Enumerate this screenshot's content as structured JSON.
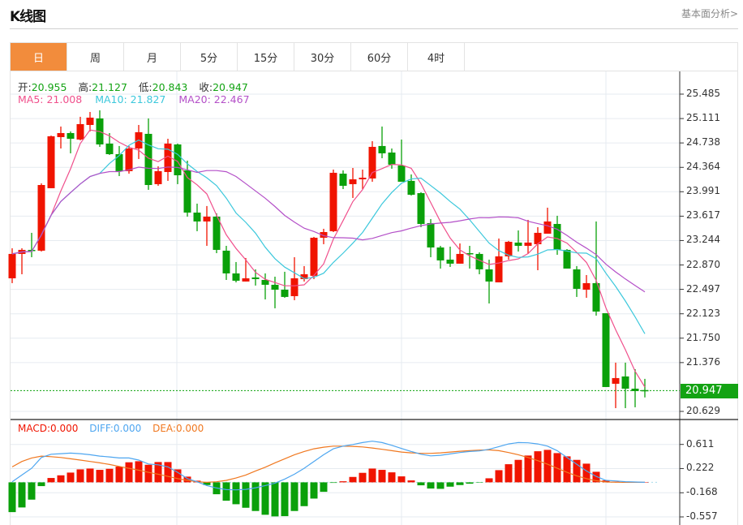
{
  "header": {
    "title": "K线图",
    "more_link": "基本面分析>"
  },
  "tabs": [
    {
      "label": "日",
      "active": true
    },
    {
      "label": "周"
    },
    {
      "label": "月"
    },
    {
      "label": "5分"
    },
    {
      "label": "15分"
    },
    {
      "label": "30分"
    },
    {
      "label": "60分"
    },
    {
      "label": "4时"
    }
  ],
  "ohlc": {
    "open_label": "开:",
    "open": "20.955",
    "high_label": "高:",
    "high": "21.127",
    "low_label": "低:",
    "low": "20.843",
    "close_label": "收:",
    "close": "20.947"
  },
  "ma_legend": {
    "ma5": "MA5: 21.008",
    "ma10": "MA10: 21.827",
    "ma20": "MA20: 22.467"
  },
  "macd_legend": {
    "macd": "MACD:0.000",
    "diff": "DIFF:0.000",
    "dea": "DEA:0.000"
  },
  "last_price": "20.947",
  "colors": {
    "up": "#f01400",
    "down": "#0aa00a",
    "ma5": "#f0508c",
    "ma10": "#3cc8dc",
    "ma20": "#b450c8",
    "diff": "#4ea6f0",
    "dea": "#f07820",
    "accent": "#f28c3c"
  },
  "chart_data": [
    {
      "type": "candlestick",
      "title": "K线图",
      "ylim": [
        20.629,
        25.485
      ],
      "y_ticks": [
        "25.485",
        "25.111",
        "24.738",
        "24.364",
        "23.991",
        "23.617",
        "23.244",
        "22.870",
        "22.497",
        "22.123",
        "21.750",
        "21.376",
        "20.629"
      ],
      "grid": true,
      "series_fields": [
        "open",
        "close",
        "high",
        "low"
      ],
      "candles": [
        [
          22.666,
          23.039,
          23.126,
          22.592
        ],
        [
          23.039,
          23.101,
          23.126,
          22.728
        ],
        [
          23.101,
          23.089,
          23.362,
          22.989
        ],
        [
          23.089,
          24.094,
          24.119,
          23.076
        ],
        [
          24.045,
          24.84,
          24.85,
          24.045
        ],
        [
          24.827,
          24.889,
          24.989,
          24.653
        ],
        [
          24.889,
          24.802,
          24.914,
          24.579
        ],
        [
          24.79,
          25.026,
          25.138,
          24.778
        ],
        [
          25.013,
          25.125,
          25.212,
          24.914
        ],
        [
          25.113,
          24.715,
          25.237,
          24.678
        ],
        [
          24.728,
          24.566,
          24.889,
          24.554
        ],
        [
          24.566,
          24.306,
          24.691,
          24.231
        ],
        [
          24.306,
          24.653,
          24.691,
          24.268
        ],
        [
          24.653,
          24.902,
          25.013,
          24.492
        ],
        [
          24.877,
          24.094,
          25.113,
          24.02
        ],
        [
          24.107,
          24.306,
          24.38,
          24.082
        ],
        [
          24.293,
          24.728,
          24.802,
          24.157
        ],
        [
          24.715,
          24.243,
          24.728,
          24.107
        ],
        [
          24.318,
          23.672,
          24.467,
          23.61
        ],
        [
          23.672,
          23.536,
          23.809,
          23.387
        ],
        [
          23.536,
          23.61,
          23.772,
          23.163
        ],
        [
          23.61,
          23.101,
          23.66,
          23.051
        ],
        [
          23.089,
          22.741,
          23.163,
          22.641
        ],
        [
          22.741,
          22.629,
          22.915,
          22.604
        ],
        [
          22.617,
          22.666,
          22.977,
          22.617
        ],
        [
          22.679,
          22.654,
          22.803,
          22.555
        ],
        [
          22.641,
          22.567,
          22.741,
          22.343
        ],
        [
          22.567,
          22.492,
          22.691,
          22.207
        ],
        [
          22.492,
          22.381,
          22.766,
          22.368
        ],
        [
          22.393,
          22.666,
          22.989,
          22.331
        ],
        [
          22.654,
          22.728,
          22.853,
          22.617
        ],
        [
          22.704,
          23.287,
          23.3,
          22.654
        ],
        [
          23.287,
          23.374,
          23.424,
          23.188
        ],
        [
          23.387,
          24.281,
          24.33,
          23.374
        ],
        [
          24.268,
          24.082,
          24.318,
          24.032
        ],
        [
          24.107,
          24.181,
          24.355,
          23.896
        ],
        [
          24.181,
          24.206,
          24.33,
          24.032
        ],
        [
          24.194,
          24.678,
          24.765,
          24.144
        ],
        [
          24.691,
          24.579,
          24.989,
          24.504
        ],
        [
          24.591,
          24.405,
          24.653,
          24.343
        ],
        [
          24.393,
          24.144,
          24.79,
          24.144
        ],
        [
          24.157,
          23.945,
          24.256,
          23.933
        ],
        [
          23.97,
          23.498,
          23.983,
          23.449
        ],
        [
          23.511,
          23.138,
          23.573,
          22.989
        ],
        [
          23.138,
          22.94,
          23.163,
          22.815
        ],
        [
          22.952,
          22.89,
          23.151,
          22.84
        ],
        [
          22.89,
          23.039,
          23.2,
          22.89
        ],
        [
          23.051,
          23.039,
          23.163,
          22.815
        ],
        [
          23.039,
          22.803,
          23.064,
          22.728
        ],
        [
          22.803,
          22.617,
          22.952,
          22.281
        ],
        [
          22.604,
          23.002,
          23.275,
          22.604
        ],
        [
          23.002,
          23.225,
          23.238,
          22.952
        ],
        [
          23.213,
          23.163,
          23.399,
          23.076
        ],
        [
          23.163,
          23.213,
          23.56,
          23.039
        ],
        [
          23.188,
          23.362,
          23.449,
          22.79
        ],
        [
          23.349,
          23.536,
          23.747,
          23.349
        ],
        [
          23.498,
          23.101,
          23.623,
          23.026
        ],
        [
          23.101,
          22.815,
          23.113,
          22.815
        ],
        [
          22.803,
          22.505,
          22.853,
          22.381
        ],
        [
          22.492,
          22.592,
          22.716,
          22.368
        ],
        [
          22.592,
          22.157,
          23.536,
          22.095
        ],
        [
          22.132,
          21.002,
          22.132,
          21.002
        ],
        [
          21.052,
          21.139,
          21.375,
          20.679
        ],
        [
          21.164,
          20.977,
          21.375,
          20.679
        ],
        [
          20.977,
          20.94,
          21.275,
          20.692
        ],
        [
          20.955,
          20.947,
          21.127,
          20.843
        ]
      ],
      "ma_periods": [
        5,
        10,
        20
      ]
    },
    {
      "type": "bar+line",
      "title": "MACD",
      "ylim": [
        -0.557,
        0.611
      ],
      "y_ticks": [
        "0.611",
        "0.222",
        "-0.168",
        "-0.557"
      ],
      "macd": [
        -0.48,
        -0.405,
        -0.279,
        -0.061,
        0.07,
        0.113,
        0.157,
        0.209,
        0.222,
        0.201,
        0.218,
        0.253,
        0.323,
        0.34,
        0.283,
        0.327,
        0.327,
        0.209,
        0.092,
        0.026,
        -0.044,
        -0.192,
        -0.296,
        -0.353,
        -0.41,
        -0.462,
        -0.523,
        -0.549,
        -0.545,
        -0.462,
        -0.384,
        -0.262,
        -0.153,
        -0.009,
        0.017,
        0.087,
        0.153,
        0.222,
        0.201,
        0.161,
        0.096,
        0.031,
        -0.048,
        -0.1,
        -0.105,
        -0.07,
        -0.044,
        -0.022,
        -0.004,
        0.065,
        0.196,
        0.292,
        0.362,
        0.432,
        0.501,
        0.523,
        0.471,
        0.419,
        0.362,
        0.301,
        0.17,
        0.031,
        0.01,
        0,
        0,
        0
      ],
      "diff": [
        0.009,
        0.118,
        0.227,
        0.401,
        0.453,
        0.462,
        0.471,
        0.462,
        0.445,
        0.423,
        0.41,
        0.392,
        0.392,
        0.358,
        0.296,
        0.283,
        0.249,
        0.161,
        0.061,
        0.009,
        -0.052,
        -0.092,
        -0.118,
        -0.122,
        -0.113,
        -0.087,
        -0.052,
        -0.013,
        0.052,
        0.131,
        0.227,
        0.336,
        0.445,
        0.541,
        0.584,
        0.61,
        0.641,
        0.663,
        0.641,
        0.597,
        0.545,
        0.497,
        0.453,
        0.427,
        0.436,
        0.458,
        0.48,
        0.497,
        0.506,
        0.532,
        0.576,
        0.619,
        0.641,
        0.637,
        0.619,
        0.584,
        0.51,
        0.401,
        0.292,
        0.183,
        0.096,
        0.031,
        0.022,
        0.01,
        0.005,
        0
      ],
      "dea": [
        0.249,
        0.336,
        0.392,
        0.423,
        0.414,
        0.401,
        0.379,
        0.358,
        0.336,
        0.314,
        0.288,
        0.257,
        0.227,
        0.196,
        0.161,
        0.131,
        0.096,
        0.061,
        0.031,
        0.009,
        0,
        0.009,
        0.031,
        0.07,
        0.118,
        0.183,
        0.244,
        0.314,
        0.379,
        0.445,
        0.497,
        0.541,
        0.567,
        0.584,
        0.584,
        0.58,
        0.571,
        0.554,
        0.532,
        0.51,
        0.488,
        0.475,
        0.467,
        0.467,
        0.475,
        0.488,
        0.501,
        0.51,
        0.519,
        0.523,
        0.51,
        0.48,
        0.445,
        0.401,
        0.349,
        0.292,
        0.227,
        0.161,
        0.105,
        0.061,
        0.026,
        0.005,
        0.002,
        0,
        0,
        0
      ]
    }
  ]
}
